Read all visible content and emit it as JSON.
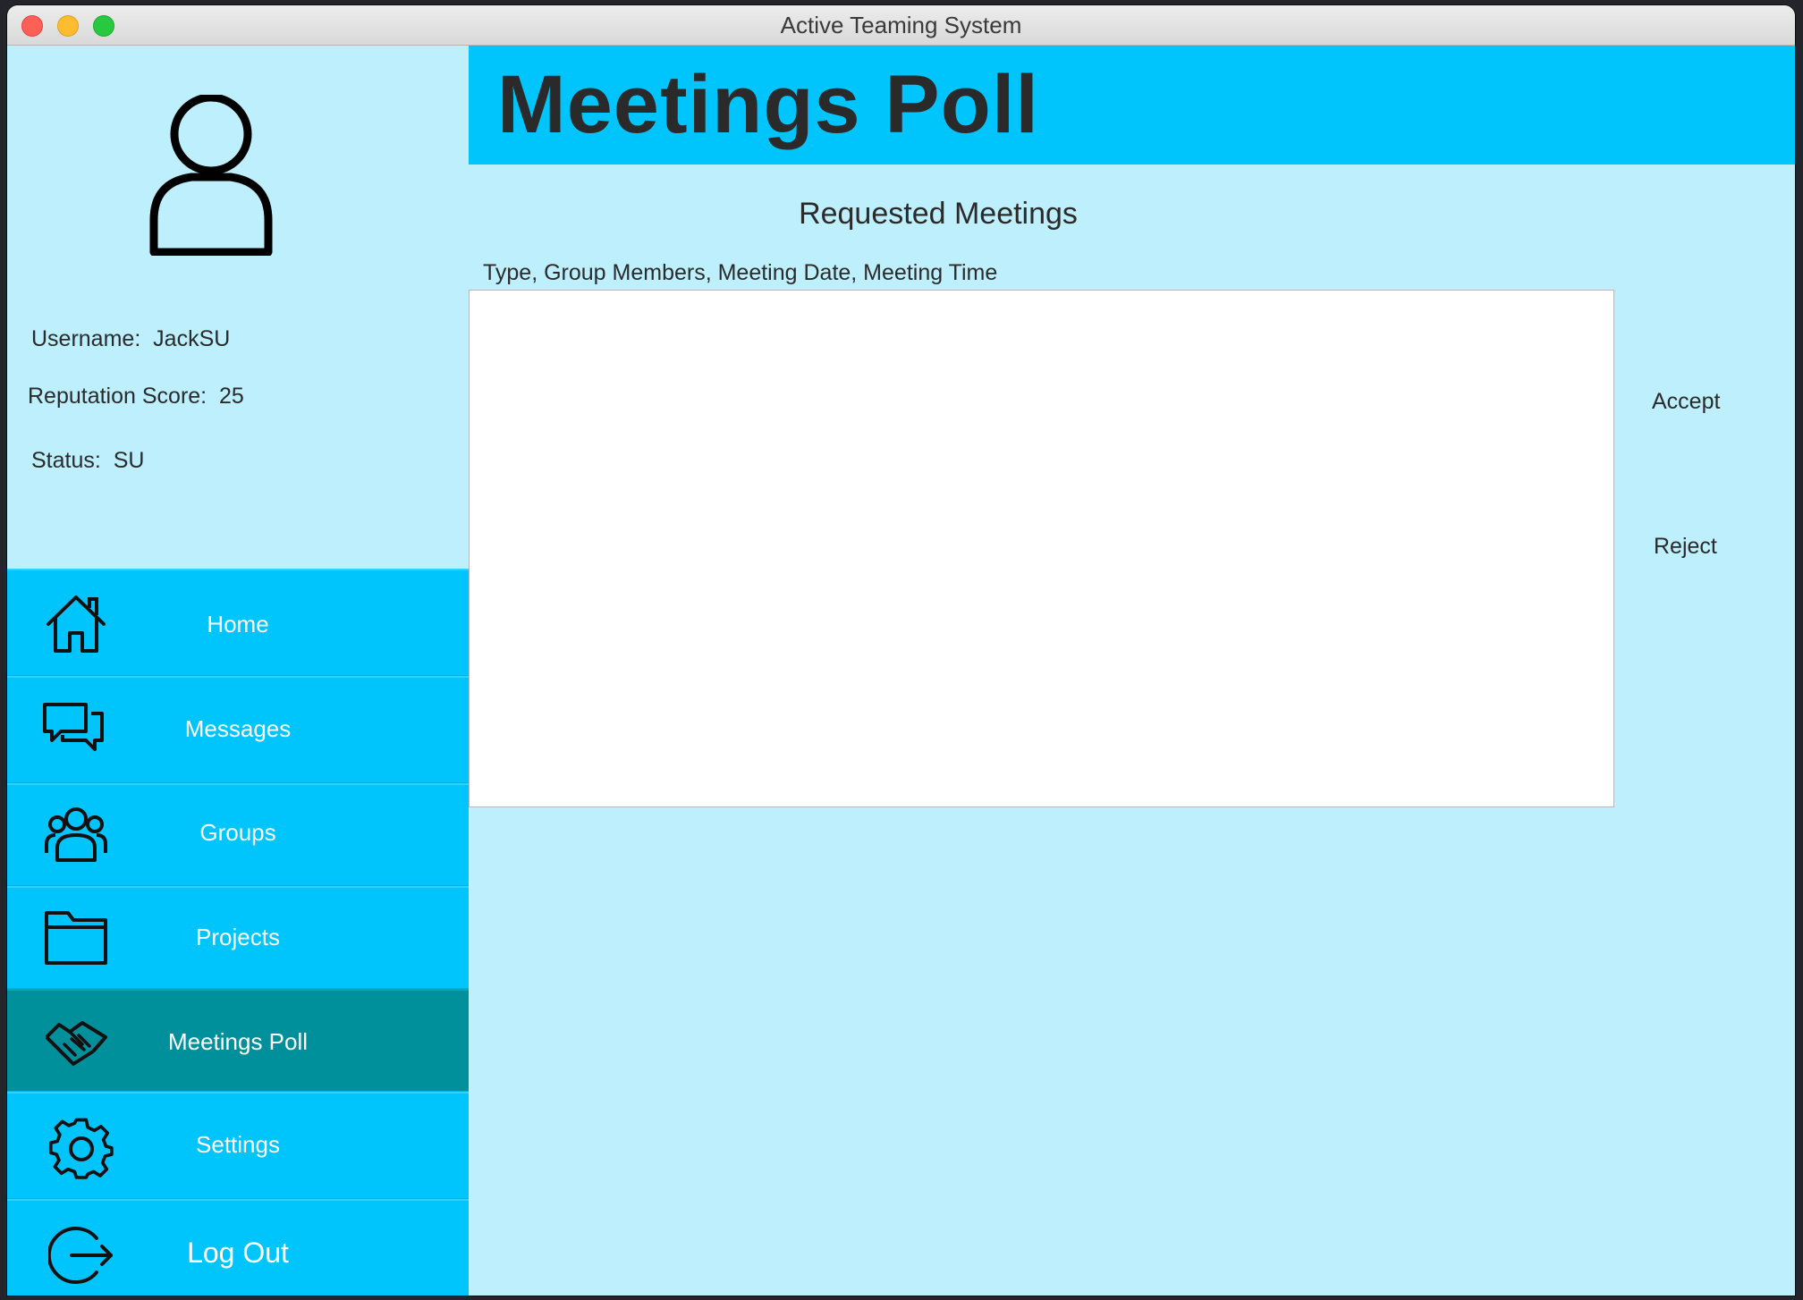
{
  "window": {
    "title": "Active Teaming System"
  },
  "profile": {
    "username_label": "Username:",
    "username": "JackSU",
    "reputation_label": "Reputation Score:",
    "reputation": "25",
    "status_label": "Status:",
    "status": "SU"
  },
  "nav": {
    "items": [
      {
        "label": "Home",
        "icon": "home-icon"
      },
      {
        "label": "Messages",
        "icon": "messages-icon"
      },
      {
        "label": "Groups",
        "icon": "groups-icon"
      },
      {
        "label": "Projects",
        "icon": "folder-icon"
      },
      {
        "label": "Meetings Poll",
        "icon": "handshake-icon",
        "active": true
      },
      {
        "label": "Settings",
        "icon": "gear-icon"
      },
      {
        "label": "Log Out",
        "icon": "logout-icon"
      }
    ]
  },
  "main": {
    "page_title": "Meetings Poll",
    "section_title": "Requested Meetings",
    "columns_label": "Type, Group Members, Meeting Date, Meeting Time",
    "meetings": [],
    "accept_label": "Accept",
    "reject_label": "Reject"
  },
  "colors": {
    "accent": "#00c5fd",
    "background": "#bdeffd",
    "active_nav": "#00909c"
  }
}
